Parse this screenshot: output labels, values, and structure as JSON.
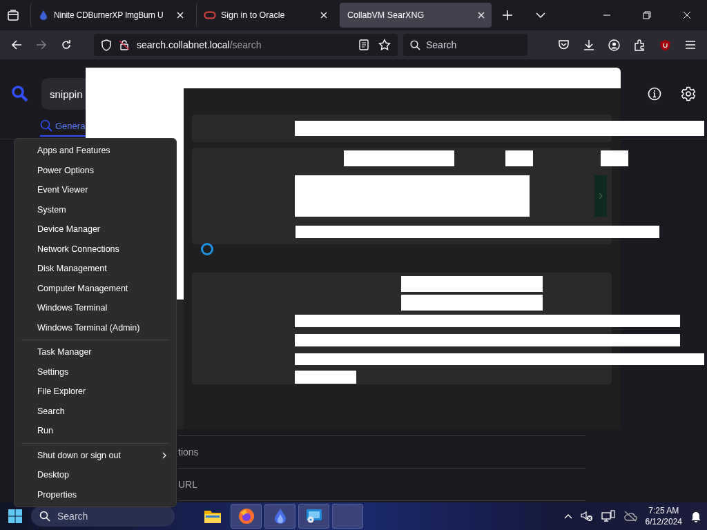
{
  "browser": {
    "tabs": [
      {
        "title": "Ninite CDBurnerXP ImgBurn U",
        "kind": "ninite",
        "selected": false
      },
      {
        "title": "Sign in to Oracle",
        "kind": "oracle",
        "selected": false
      },
      {
        "title": "CollabVM SearXNG",
        "kind": "plain",
        "selected": true
      }
    ],
    "url_host": "search.collabnet.local",
    "url_path": "/search",
    "search_placeholder": "Search"
  },
  "page": {
    "query": "snippin",
    "categories": [
      {
        "label": "Genera",
        "selected": true
      }
    ],
    "option_rows": [
      "tions",
      "URL"
    ]
  },
  "context_menu": {
    "groups": [
      [
        {
          "label": "Apps and Features",
          "submenu": false
        },
        {
          "label": "Power Options",
          "submenu": false
        },
        {
          "label": "Event Viewer",
          "submenu": false
        },
        {
          "label": "System",
          "submenu": false
        },
        {
          "label": "Device Manager",
          "submenu": false
        },
        {
          "label": "Network Connections",
          "submenu": false
        },
        {
          "label": "Disk Management",
          "submenu": false
        },
        {
          "label": "Computer Management",
          "submenu": false
        },
        {
          "label": "Windows Terminal",
          "submenu": false
        },
        {
          "label": "Windows Terminal (Admin)",
          "submenu": false
        }
      ],
      [
        {
          "label": "Task Manager",
          "submenu": false
        },
        {
          "label": "Settings",
          "submenu": false
        },
        {
          "label": "File Explorer",
          "submenu": false
        },
        {
          "label": "Search",
          "submenu": false
        },
        {
          "label": "Run",
          "submenu": false
        }
      ],
      [
        {
          "label": "Shut down or sign out",
          "submenu": true
        },
        {
          "label": "Desktop",
          "submenu": false
        },
        {
          "label": "Properties",
          "submenu": false
        }
      ]
    ]
  },
  "taskbar": {
    "search_placeholder": "Search",
    "apps": [
      {
        "kind": "folder"
      },
      {
        "kind": "firefox"
      },
      {
        "kind": "ninite"
      },
      {
        "kind": "remote"
      },
      {
        "kind": "blank"
      }
    ],
    "time": "7:25 AM",
    "date": "6/12/2024"
  }
}
